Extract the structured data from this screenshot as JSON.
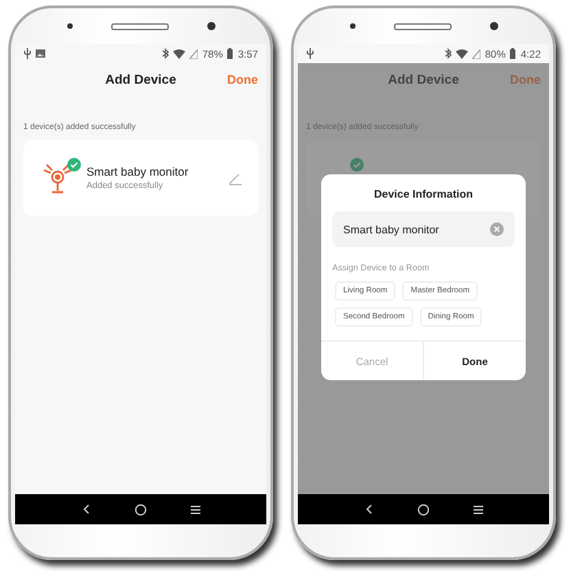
{
  "phones": [
    {
      "status_bar": {
        "image_notification": true,
        "battery": "78%",
        "time": "3:57"
      },
      "header": {
        "title": "Add Device",
        "action": "Done"
      },
      "message": "1 device(s) added successfully",
      "device": {
        "name": "Smart baby monitor",
        "status": "Added successfully"
      }
    },
    {
      "status_bar": {
        "image_notification": false,
        "battery": "80%",
        "time": "4:22"
      },
      "header": {
        "title": "Add Device",
        "action": "Done"
      },
      "message": "1 device(s) added successfully",
      "dialog": {
        "title": "Device Information",
        "name_value": "Smart baby monitor",
        "section_label": "Assign Device to a Room",
        "rooms": [
          "Living Room",
          "Master Bedroom",
          "Second Bedroom",
          "Dining Room"
        ],
        "cancel": "Cancel",
        "confirm": "Done"
      }
    }
  ]
}
